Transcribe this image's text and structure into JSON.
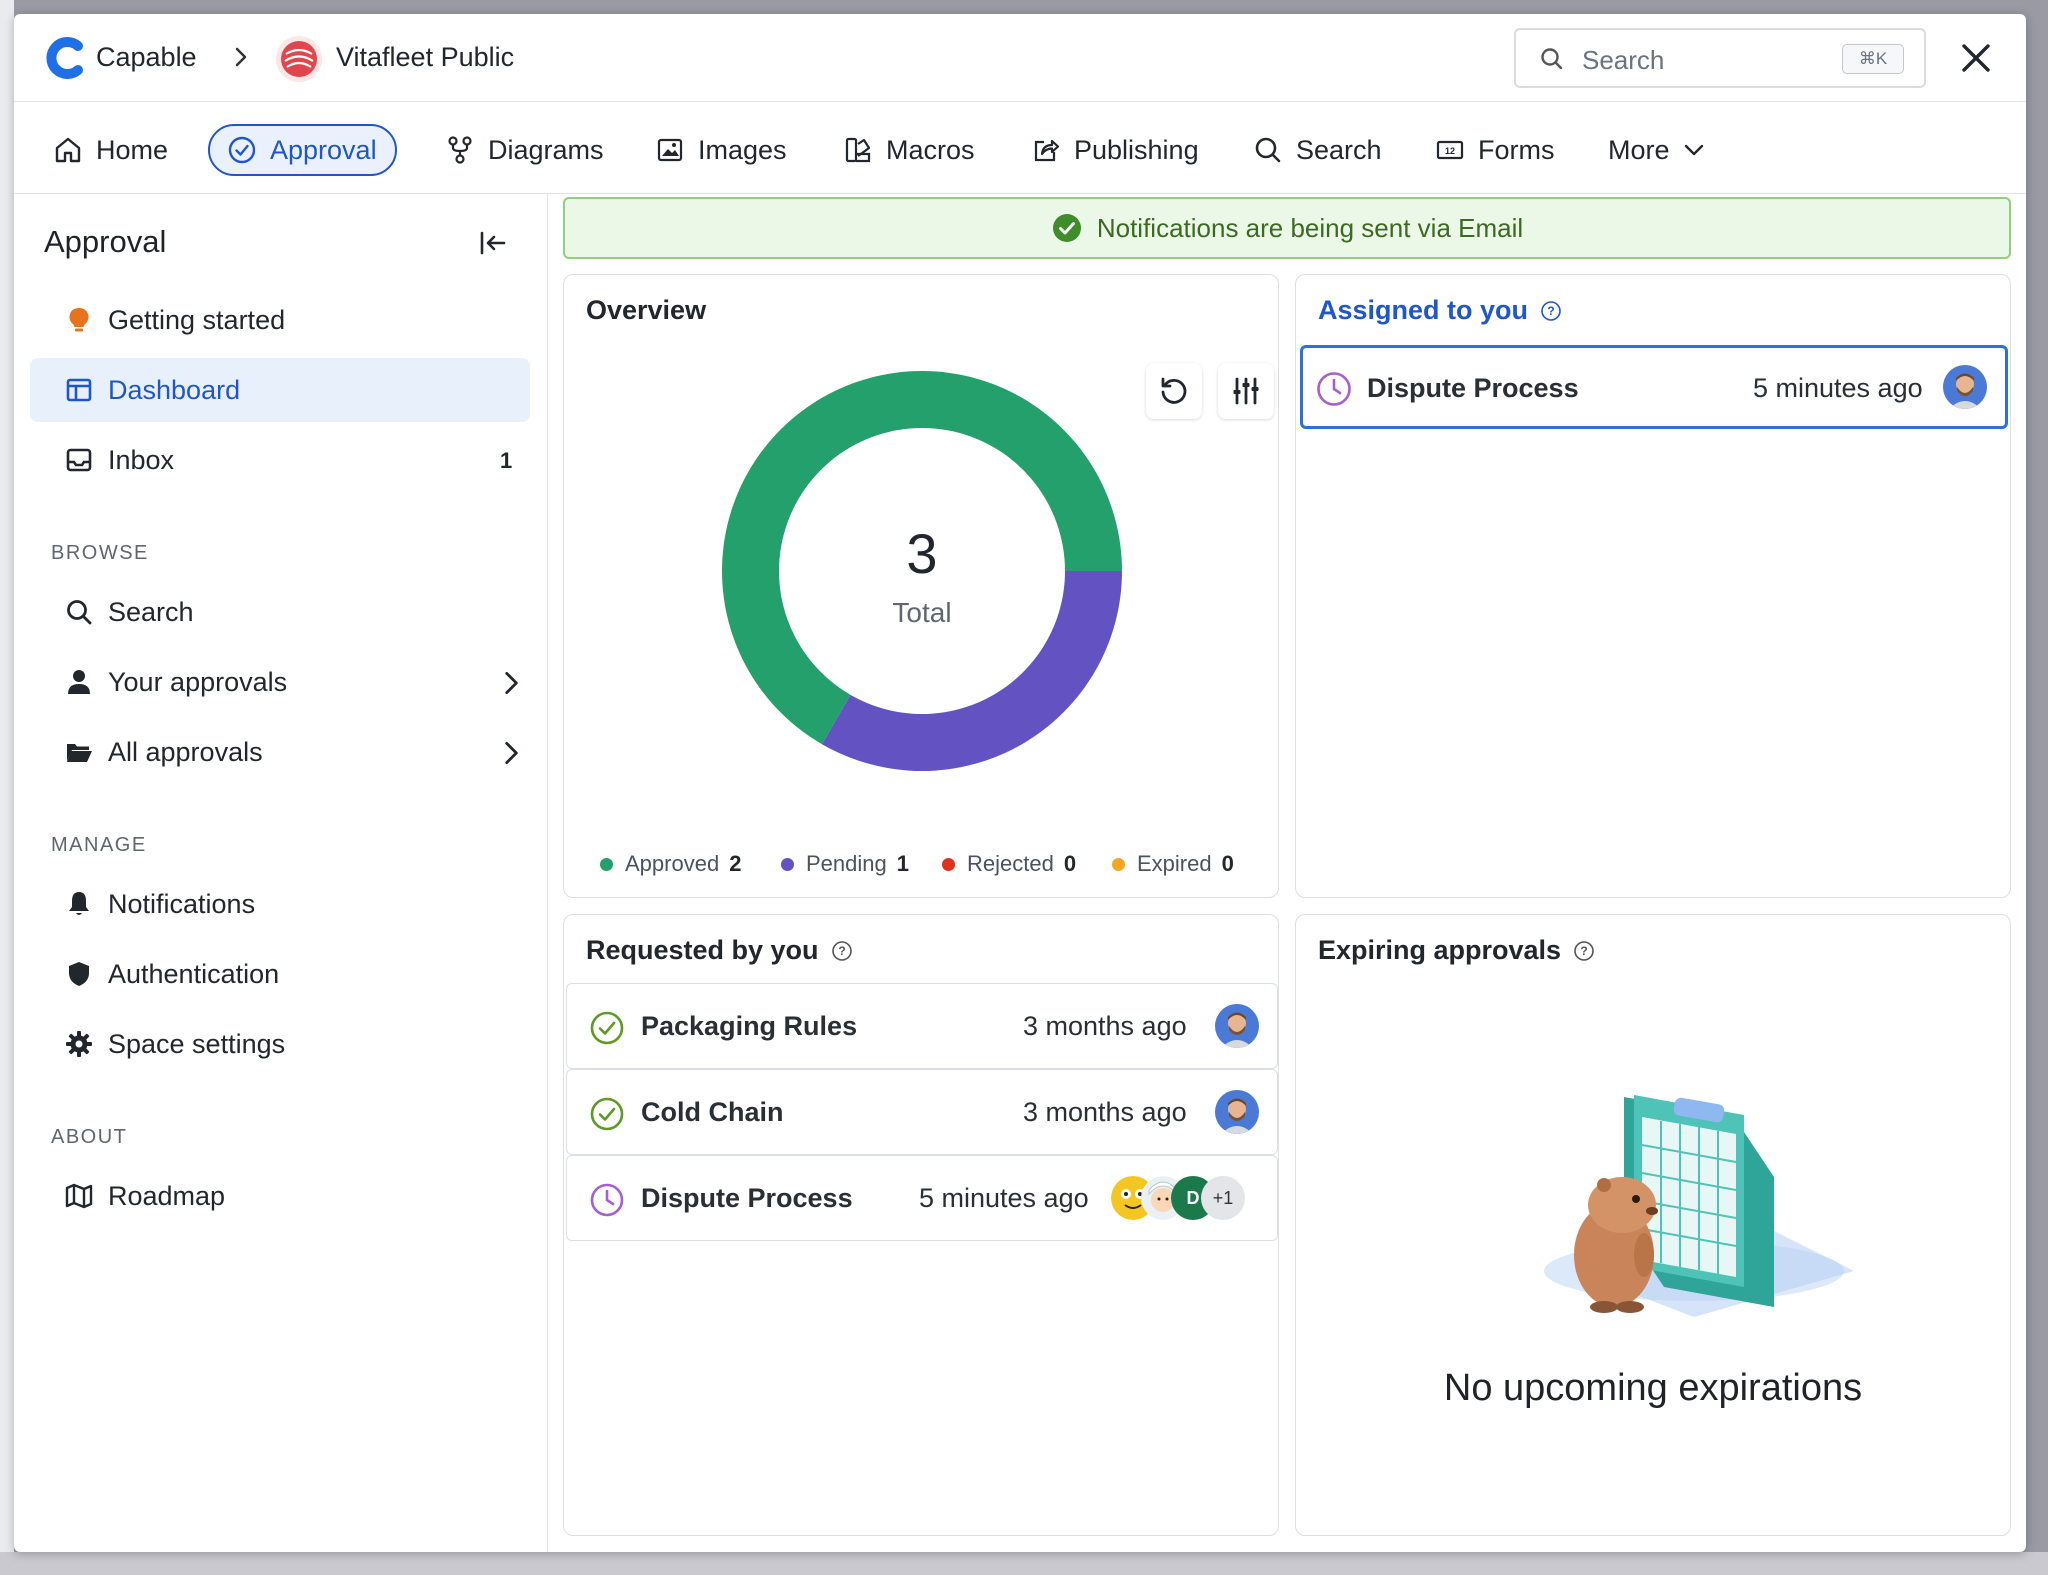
{
  "header": {
    "app_name": "Capable",
    "space_name": "Vitafleet Public",
    "search_placeholder": "Search",
    "search_shortcut": "⌘K"
  },
  "nav": {
    "items": [
      {
        "label": "Home",
        "icon": "home-icon"
      },
      {
        "label": "Approval",
        "icon": "check-circle-icon",
        "active": true
      },
      {
        "label": "Diagrams",
        "icon": "diagram-icon"
      },
      {
        "label": "Images",
        "icon": "image-icon"
      },
      {
        "label": "Macros",
        "icon": "macros-icon"
      },
      {
        "label": "Publishing",
        "icon": "share-icon"
      },
      {
        "label": "Search",
        "icon": "search-icon"
      },
      {
        "label": "Forms",
        "icon": "forms-icon"
      },
      {
        "label": "More",
        "icon": "chevron-down-icon"
      }
    ]
  },
  "sidebar": {
    "title": "Approval",
    "items": [
      {
        "label": "Getting started",
        "icon": "lightbulb-icon"
      },
      {
        "label": "Dashboard",
        "icon": "dashboard-icon",
        "active": true
      },
      {
        "label": "Inbox",
        "icon": "inbox-icon",
        "count": "1"
      }
    ],
    "browse_heading": "BROWSE",
    "browse": [
      {
        "label": "Search",
        "icon": "search-icon"
      },
      {
        "label": "Your approvals",
        "icon": "user-icon"
      },
      {
        "label": "All approvals",
        "icon": "folder-icon"
      }
    ],
    "manage_heading": "MANAGE",
    "manage": [
      {
        "label": "Notifications",
        "icon": "bell-icon"
      },
      {
        "label": "Authentication",
        "icon": "shield-icon"
      },
      {
        "label": "Space settings",
        "icon": "gear-icon"
      }
    ],
    "about_heading": "ABOUT",
    "about": [
      {
        "label": "Roadmap",
        "icon": "map-icon"
      }
    ]
  },
  "banner": {
    "text": "Notifications are being sent via Email",
    "color": "#3d6a22"
  },
  "overview": {
    "title": "Overview",
    "total_value": "3",
    "total_label": "Total",
    "legend": [
      {
        "label": "Approved",
        "value": "2",
        "color": "#23a06b"
      },
      {
        "label": "Pending",
        "value": "1",
        "color": "#6352c2"
      },
      {
        "label": "Rejected",
        "value": "0",
        "color": "#e0301e"
      },
      {
        "label": "Expired",
        "value": "0",
        "color": "#f5a623"
      }
    ]
  },
  "chart_data": {
    "type": "pie",
    "categories": [
      "Approved",
      "Pending",
      "Rejected",
      "Expired"
    ],
    "values": [
      2,
      1,
      0,
      0
    ],
    "colors": [
      "#23a06b",
      "#6352c2",
      "#e0301e",
      "#f5a623"
    ],
    "title": "",
    "center_label": "3 Total",
    "legend_position": "bottom"
  },
  "assigned": {
    "title": "Assigned to you",
    "items": [
      {
        "name": "Dispute Process",
        "time": "5 minutes ago",
        "status": "pending"
      }
    ]
  },
  "requested": {
    "title": "Requested by you",
    "items": [
      {
        "name": "Packaging Rules",
        "time": "3 months ago",
        "status": "approved"
      },
      {
        "name": "Cold Chain",
        "time": "3 months ago",
        "status": "approved"
      },
      {
        "name": "Dispute Process",
        "time": "5 minutes ago",
        "status": "pending",
        "avatar_initial": "D",
        "more_count": "+1"
      }
    ]
  },
  "expiring": {
    "title": "Expiring approvals",
    "empty_text": "No upcoming expirations"
  }
}
